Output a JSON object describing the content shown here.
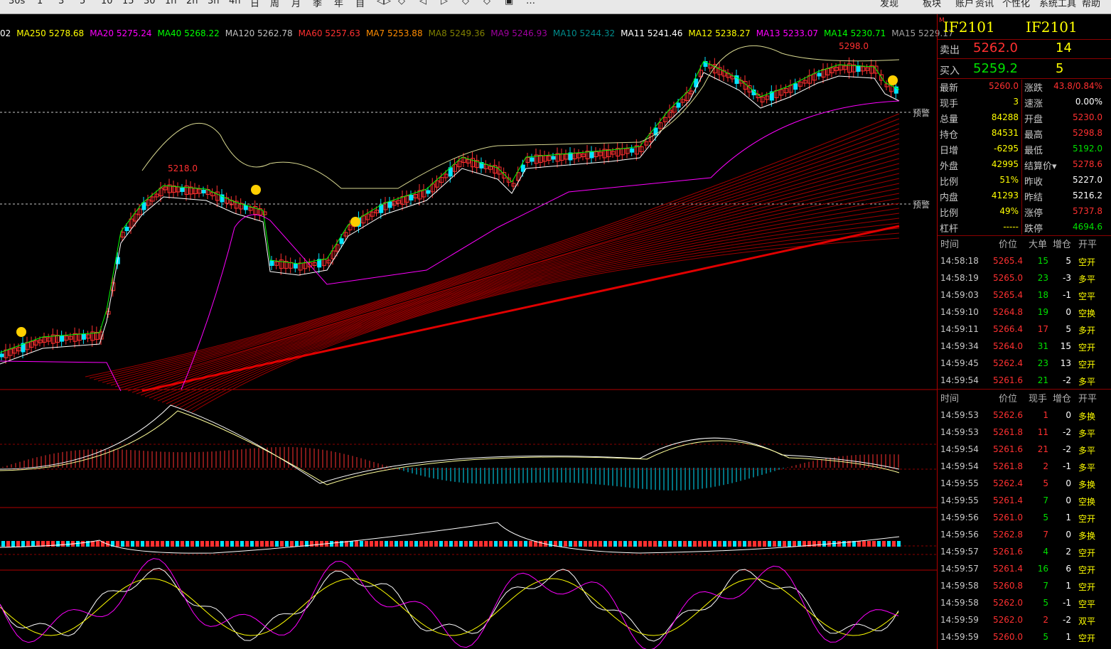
{
  "toolbar": {
    "items": [
      "30s",
      "1",
      "3",
      "5",
      "10",
      "15",
      "30",
      "1h",
      "2h",
      "3h",
      "4h",
      "日",
      "周",
      "月",
      "季",
      "年",
      "自",
      "◁▷",
      "◇",
      "◁",
      "▷",
      "◇",
      "◇",
      "▣",
      "…",
      "发现",
      "板块",
      "账户",
      "资讯",
      "个性化",
      "系统工具",
      "帮助"
    ]
  },
  "ma_legend": [
    {
      "text": "02",
      "color": "#ffffff"
    },
    {
      "text": "MA250 5278.68",
      "color": "#ffff00"
    },
    {
      "text": "MA20 5275.24",
      "color": "#ff00ff"
    },
    {
      "text": "MA40 5268.22",
      "color": "#00ff00"
    },
    {
      "text": "MA120 5262.78",
      "color": "#c0c0c0"
    },
    {
      "text": "MA60 5257.63",
      "color": "#ff3030"
    },
    {
      "text": "MA7 5253.88",
      "color": "#ff8c00"
    },
    {
      "text": "MA8 5249.36",
      "color": "#808000"
    },
    {
      "text": "MA9 5246.93",
      "color": "#a000a0"
    },
    {
      "text": "MA10 5244.32",
      "color": "#008b8b"
    },
    {
      "text": "MA11 5241.46",
      "color": "#ffffff"
    },
    {
      "text": "MA12 5238.27",
      "color": "#ffff00"
    },
    {
      "text": "MA13 5233.07",
      "color": "#ff00ff"
    },
    {
      "text": "MA14 5230.71",
      "color": "#00ff00"
    },
    {
      "text": "MA15 5229.17",
      "color": "#a0a0a0"
    }
  ],
  "chart_labels": {
    "high_label": "5298.0",
    "peak_label": "5218.0",
    "alert_label_1": "预警",
    "alert_label_2": "预警"
  },
  "quote": {
    "symbol_1": "IF2101",
    "symbol_2": "IF2101",
    "sell_label": "卖出",
    "sell_price": "5262.0",
    "sell_vol": "14",
    "buy_label": "买入",
    "buy_price": "5259.2",
    "buy_vol": "5",
    "left": [
      {
        "label": "最新",
        "value": "5260.0",
        "color": "red"
      },
      {
        "label": "现手",
        "value": "3",
        "color": "yellow"
      },
      {
        "label": "总量",
        "value": "84288",
        "color": "yellow"
      },
      {
        "label": "持仓",
        "value": "84531",
        "color": "yellow"
      },
      {
        "label": "日增",
        "value": "-6295",
        "color": "yellow"
      },
      {
        "label": "外盘",
        "value": "42995",
        "color": "yellow"
      },
      {
        "label": "比例",
        "value": "51%",
        "color": "yellow"
      },
      {
        "label": "内盘",
        "value": "41293",
        "color": "yellow"
      },
      {
        "label": "比例",
        "value": "49%",
        "color": "yellow"
      },
      {
        "label": "杠杆",
        "value": "-----",
        "color": "yellow"
      }
    ],
    "right": [
      {
        "label": "涨跌",
        "value": "43.8/0.84%",
        "color": "red"
      },
      {
        "label": "速涨",
        "value": "0.00%",
        "color": "white"
      },
      {
        "label": "开盘",
        "value": "5230.0",
        "color": "red"
      },
      {
        "label": "最高",
        "value": "5298.8",
        "color": "red"
      },
      {
        "label": "最低",
        "value": "5192.0",
        "color": "green"
      },
      {
        "label": "结算价▾",
        "value": "5278.6",
        "color": "red"
      },
      {
        "label": "昨收",
        "value": "5227.0",
        "color": "white"
      },
      {
        "label": "昨结",
        "value": "5216.2",
        "color": "white"
      },
      {
        "label": "涨停",
        "value": "5737.8",
        "color": "red"
      },
      {
        "label": "跌停",
        "value": "4694.6",
        "color": "green"
      }
    ]
  },
  "big_orders": {
    "headers": [
      "时间",
      "价位",
      "大单",
      "增仓",
      "开平"
    ],
    "rows": [
      {
        "time": "14:58:18",
        "price": "5265.4",
        "vol": "15",
        "chg": "5",
        "type": "空开"
      },
      {
        "time": "14:58:19",
        "price": "5265.0",
        "vol": "23",
        "chg": "-3",
        "type": "多平"
      },
      {
        "time": "14:59:03",
        "price": "5265.4",
        "vol": "18",
        "chg": "-1",
        "type": "空平"
      },
      {
        "time": "14:59:10",
        "price": "5264.8",
        "vol": "19",
        "chg": "0",
        "type": "空换"
      },
      {
        "time": "14:59:11",
        "price": "5266.4",
        "vol": "17",
        "chg": "5",
        "type": "多开"
      },
      {
        "time": "14:59:34",
        "price": "5264.0",
        "vol": "31",
        "chg": "15",
        "type": "空开"
      },
      {
        "time": "14:59:45",
        "price": "5262.4",
        "vol": "23",
        "chg": "13",
        "type": "空开"
      },
      {
        "time": "14:59:54",
        "price": "5261.6",
        "vol": "21",
        "chg": "-2",
        "type": "多平"
      }
    ]
  },
  "ticks": {
    "headers": [
      "时间",
      "价位",
      "现手",
      "增仓",
      "开平"
    ],
    "rows": [
      {
        "time": "14:59:53",
        "price": "5262.6",
        "vol": "1",
        "chg": "0",
        "type": "多换"
      },
      {
        "time": "14:59:53",
        "price": "5261.8",
        "vol": "11",
        "chg": "-2",
        "type": "多平"
      },
      {
        "time": "14:59:54",
        "price": "5261.6",
        "vol": "21",
        "chg": "-2",
        "type": "多平"
      },
      {
        "time": "14:59:54",
        "price": "5261.8",
        "vol": "2",
        "chg": "-1",
        "type": "多平"
      },
      {
        "time": "14:59:55",
        "price": "5262.4",
        "vol": "5",
        "chg": "0",
        "type": "多换"
      },
      {
        "time": "14:59:55",
        "price": "5261.4",
        "vol": "7",
        "chg": "0",
        "type": "空换"
      },
      {
        "time": "14:59:56",
        "price": "5261.0",
        "vol": "5",
        "chg": "1",
        "type": "空开"
      },
      {
        "time": "14:59:56",
        "price": "5262.8",
        "vol": "7",
        "chg": "0",
        "type": "多换"
      },
      {
        "time": "14:59:57",
        "price": "5261.6",
        "vol": "4",
        "chg": "2",
        "type": "空开"
      },
      {
        "time": "14:59:57",
        "price": "5261.4",
        "vol": "16",
        "chg": "6",
        "type": "空开"
      },
      {
        "time": "14:59:58",
        "price": "5260.8",
        "vol": "7",
        "chg": "1",
        "type": "空开"
      },
      {
        "time": "14:59:58",
        "price": "5262.0",
        "vol": "5",
        "chg": "-1",
        "type": "空平"
      },
      {
        "time": "14:59:59",
        "price": "5262.0",
        "vol": "2",
        "chg": "-2",
        "type": "双平"
      },
      {
        "time": "14:59:59",
        "price": "5260.0",
        "vol": "5",
        "chg": "1",
        "type": "空开"
      }
    ]
  },
  "colors": {
    "up": "#ff3030",
    "down": "#00e5ff",
    "grid": "#8b0000",
    "bg": "#000000"
  }
}
